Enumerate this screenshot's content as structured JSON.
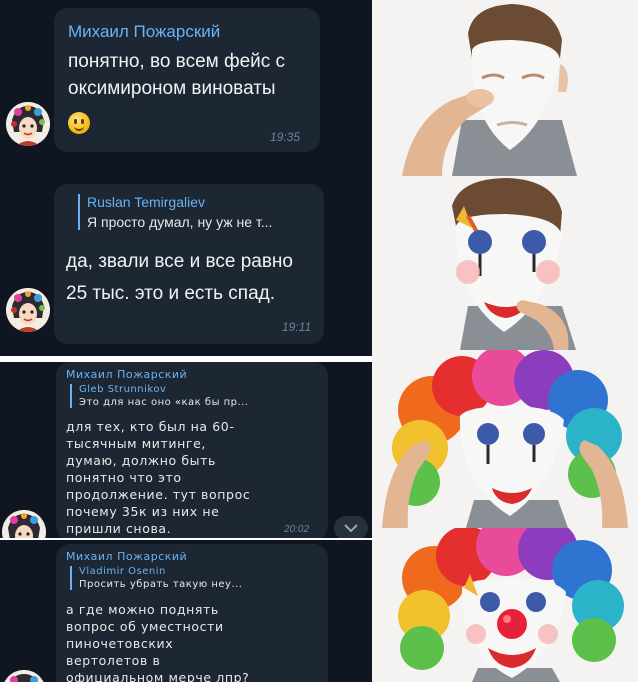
{
  "chat": {
    "messages": [
      {
        "sender": "Михаил Пожарский",
        "lines": [
          "понятно, во всем фейс с",
          "оксимироном виноваты"
        ],
        "emoji": "smiling-face-emoji",
        "time": "19:35"
      },
      {
        "reply_to": {
          "name": "Ruslan Temirgaliev",
          "text": "Я просто думал, ну уж не т..."
        },
        "lines": [
          "да, звали все и все равно",
          "25 тыс. это и есть спад."
        ],
        "time": "19:11"
      },
      {
        "sender": "Михаил Пожарский",
        "reply_to": {
          "name": "Gleb Strunnikov",
          "text": "Это для нас оно «как бы пр..."
        },
        "lines": [
          "для тех, кто был на 60-",
          "тысячным митинге,",
          "думаю, должно быть",
          "понятно что это",
          "продолжение. тут вопрос",
          "почему 35к из них не",
          "пришли снова."
        ],
        "time": "20:02"
      },
      {
        "sender": "Михаил Пожарский",
        "reply_to": {
          "name": "Vladimir Osenin",
          "text": "Просить убрать такую неу..."
        },
        "lines": [
          "а где можно поднять",
          "вопрос об уместности",
          "пиночетовских",
          "вертолетов в",
          "официальном мерче лпр?"
        ]
      }
    ]
  },
  "meme": {
    "panels": [
      "face-paint-panel",
      "clown-makeup-panel",
      "clown-wig-panel",
      "clown-nose-panel"
    ]
  },
  "colors": {
    "chat_bg": "#0f1621",
    "bubble_bg": "#1d2733",
    "name_blue": "#6ab2f2",
    "time_gray": "#6f8396"
  }
}
